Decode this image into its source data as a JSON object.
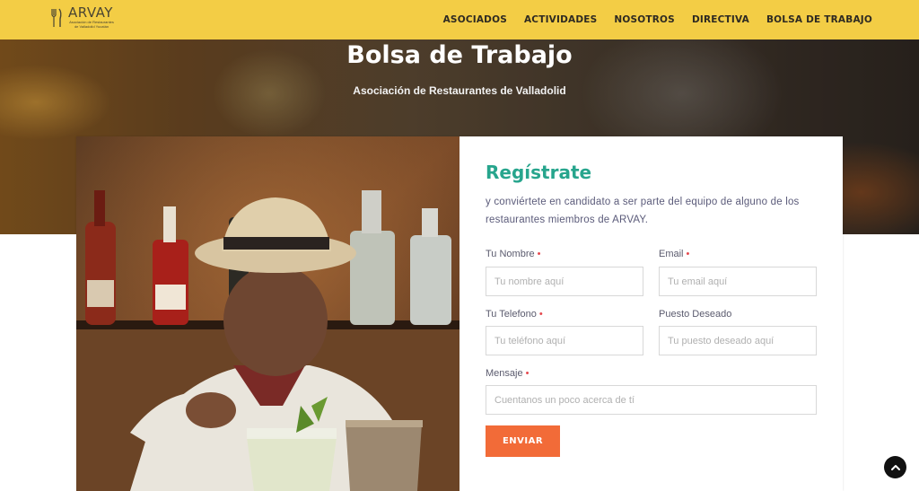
{
  "brand": {
    "name": "ARVAY",
    "tagline": "Asociación de Restaurantes de Valladolid Yucatán"
  },
  "nav": {
    "items": [
      {
        "label": "ASOCIADOS"
      },
      {
        "label": "ACTIVIDADES"
      },
      {
        "label": "NOSOTROS"
      },
      {
        "label": "DIRECTIVA"
      },
      {
        "label": "BOLSA DE TRABAJO"
      }
    ]
  },
  "hero": {
    "title": "Bolsa de Trabajo",
    "subtitle": "Asociación de Restaurantes de Valladolid"
  },
  "form": {
    "title": "Regístrate",
    "description": "y conviértete en candidato a ser parte del equipo de alguno de los restaurantes miembros de ARVAY.",
    "required_mark": "•",
    "fields": {
      "name": {
        "label": "Tu Nombre",
        "placeholder": "Tu nombre aquí",
        "value": ""
      },
      "email": {
        "label": "Email",
        "placeholder": "Tu email aquí",
        "value": ""
      },
      "phone": {
        "label": "Tu Telefono",
        "placeholder": "Tu teléfono aquí",
        "value": ""
      },
      "position": {
        "label": "Puesto Deseado",
        "placeholder": "Tu puesto deseado aquí",
        "value": ""
      },
      "message": {
        "label": "Mensaje",
        "placeholder": "Cuentanos un poco acerca de tí",
        "value": ""
      }
    },
    "submit_label": "ENVIAR"
  },
  "colors": {
    "header_bg": "#f3cd45",
    "accent_teal": "#27a58d",
    "button_orange": "#f26b38",
    "required_red": "#e5484d"
  },
  "icons": {
    "logo": "fork-knife-logo-icon",
    "scroll_top": "chevron-up-icon"
  }
}
